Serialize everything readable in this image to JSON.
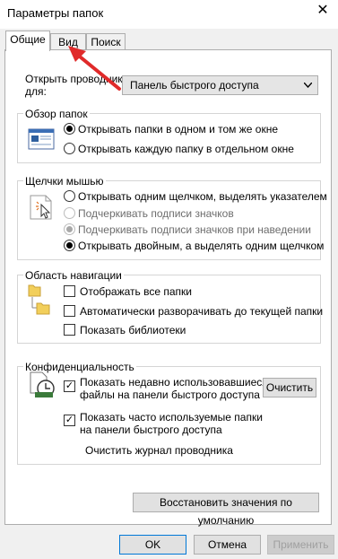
{
  "window": {
    "title": "Параметры папок",
    "close_glyph": "✕"
  },
  "tabs": [
    {
      "label": "Общие",
      "active": true
    },
    {
      "label": "Вид",
      "active": false
    },
    {
      "label": "Поиск",
      "active": false
    }
  ],
  "open_explorer": {
    "label_line1": "Открыть проводник",
    "label_line2": "для:",
    "selected": "Панель быстрого доступа"
  },
  "browse_folders": {
    "title": "Обзор папок",
    "options": [
      {
        "label": "Открывать папки в одном и том же окне",
        "selected": true
      },
      {
        "label": "Открывать каждую папку в отдельном окне",
        "selected": false
      }
    ]
  },
  "mouse_clicks": {
    "title": "Щелчки мышью",
    "options": [
      {
        "label": "Открывать одним щелчком, выделять указателем",
        "selected": false,
        "enabled": true
      },
      {
        "label": "Подчеркивать подписи значков",
        "selected": false,
        "enabled": false
      },
      {
        "label": "Подчеркивать подписи значков при наведении",
        "selected": true,
        "enabled": false
      },
      {
        "label": "Открывать двойным, а выделять одним щелчком",
        "selected": true,
        "enabled": true
      }
    ]
  },
  "navigation_pane": {
    "title": "Область навигации",
    "options": [
      {
        "label": "Отображать все папки",
        "checked": false
      },
      {
        "label": "Автоматически разворачивать до текущей папки",
        "checked": false
      },
      {
        "label": "Показать библиотеки",
        "checked": false
      }
    ]
  },
  "privacy": {
    "title": "Конфиденциальность",
    "recent_files_line1": "Показать недавно использовавшиеся",
    "recent_files_line2": "файлы на панели быстрого доступа",
    "frequent_folders_line1": "Показать часто используемые папки",
    "frequent_folders_line2": "на панели быстрого доступа",
    "recent_checked": true,
    "frequent_checked": true,
    "clear_history_label": "Очистить журнал проводника",
    "clear_button": "Очистить"
  },
  "restore_defaults_button": "Восстановить значения по умолчанию",
  "footer": {
    "ok": "OK",
    "cancel": "Отмена",
    "apply": "Применить"
  },
  "colors": {
    "annotation_arrow": "#e02a2a",
    "accent": "#0078d7"
  },
  "icons": {
    "check": "✓"
  }
}
